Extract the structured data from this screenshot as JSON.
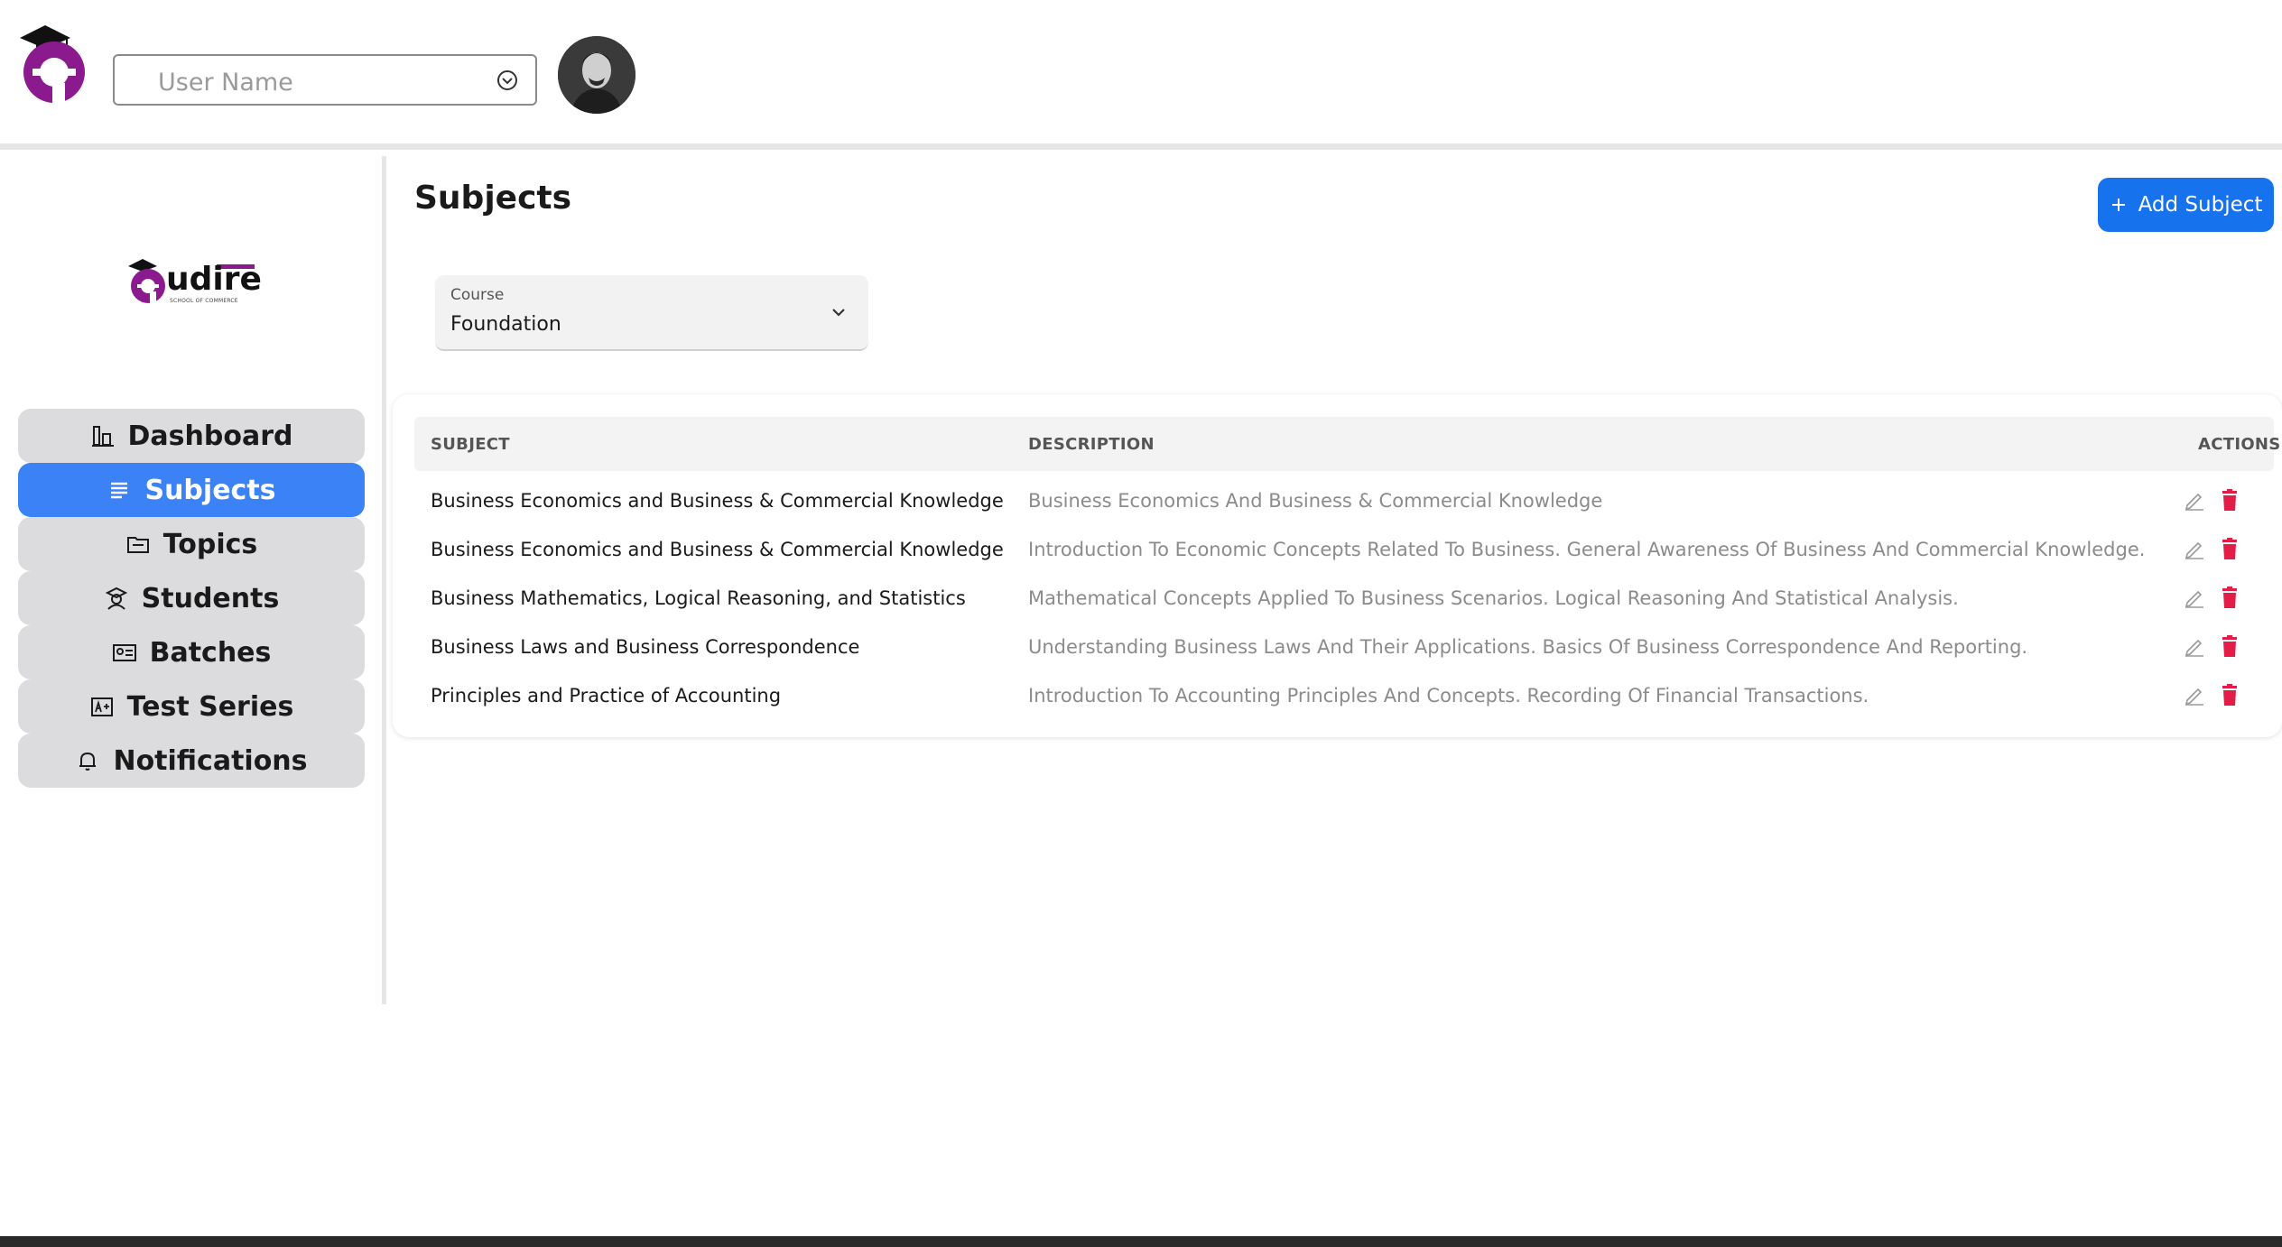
{
  "header": {
    "user_select": {
      "value": "User Name"
    },
    "logo_icon": "audire-logo-icon",
    "avatar_icon": "user-avatar"
  },
  "sidebar": {
    "brand_text": "udire",
    "brand_subtitle": "SCHOOL OF COMMERCE",
    "items": [
      {
        "label": "Dashboard",
        "icon": "chart-icon",
        "active": false
      },
      {
        "label": "Subjects",
        "icon": "list-icon",
        "active": true
      },
      {
        "label": "Topics",
        "icon": "folder-icon",
        "active": false
      },
      {
        "label": "Students",
        "icon": "student-icon",
        "active": false
      },
      {
        "label": "Batches",
        "icon": "id-card-icon",
        "active": false
      },
      {
        "label": "Test Series",
        "icon": "grade-icon",
        "active": false
      },
      {
        "label": "Notifications",
        "icon": "bell-icon",
        "active": false
      }
    ]
  },
  "main": {
    "title": "Subjects",
    "add_button": {
      "label": "Add Subject",
      "icon": "plus-icon"
    },
    "course_filter": {
      "label": "Course",
      "value": "Foundation"
    },
    "table": {
      "columns": [
        "SUBJECT",
        "DESCRIPTION",
        "ACTIONS"
      ],
      "rows": [
        {
          "subject": "Business Economics and Business & Commercial Knowledge",
          "description": "Business Economics And Business & Commercial Knowledge"
        },
        {
          "subject": "Business Economics and Business & Commercial Knowledge",
          "description": "Introduction To Economic Concepts Related To Business. General Awareness Of Business And Commercial Knowledge."
        },
        {
          "subject": "Business Mathematics, Logical Reasoning, and Statistics",
          "description": "Mathematical Concepts Applied To Business Scenarios. Logical Reasoning And Statistical Analysis."
        },
        {
          "subject": "Business Laws and Business Correspondence",
          "description": "Understanding Business Laws And Their Applications. Basics Of Business Correspondence And Reporting."
        },
        {
          "subject": "Principles and Practice of Accounting",
          "description": "Introduction To Accounting Principles And Concepts. Recording Of Financial Transactions."
        }
      ]
    }
  },
  "colors": {
    "brand_purple": "#8b1a8f",
    "primary_blue": "#1772ee",
    "active_nav": "#3b82f6",
    "delete_red": "#e11d48"
  }
}
